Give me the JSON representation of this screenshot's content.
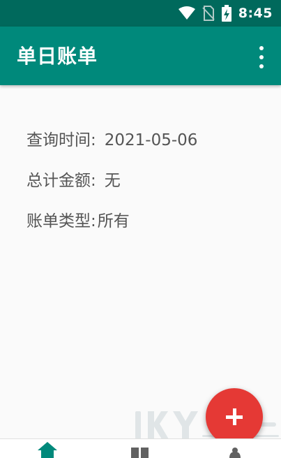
{
  "status_bar": {
    "time": "8:45",
    "icons": [
      "wifi-icon",
      "no-sim-icon",
      "battery-charging-icon"
    ]
  },
  "app_bar": {
    "title": "单日账单",
    "menu_icon": "more-vert-icon"
  },
  "info": {
    "query_time_label": "查询时间:",
    "query_time_value": "2021-05-06",
    "total_label": "总计金额:",
    "total_value": "无",
    "type_label": "账单类型:",
    "type_value": "所有"
  },
  "fab": {
    "icon": "plus-icon"
  },
  "bottom_nav": {
    "items": [
      "home-icon",
      "dashboard-icon",
      "notifications-icon"
    ]
  },
  "colors": {
    "status_bar": "#00695c",
    "app_bar": "#00897b",
    "fab": "#e53935",
    "nav_active": "#00897b",
    "nav_inactive": "#616161"
  }
}
